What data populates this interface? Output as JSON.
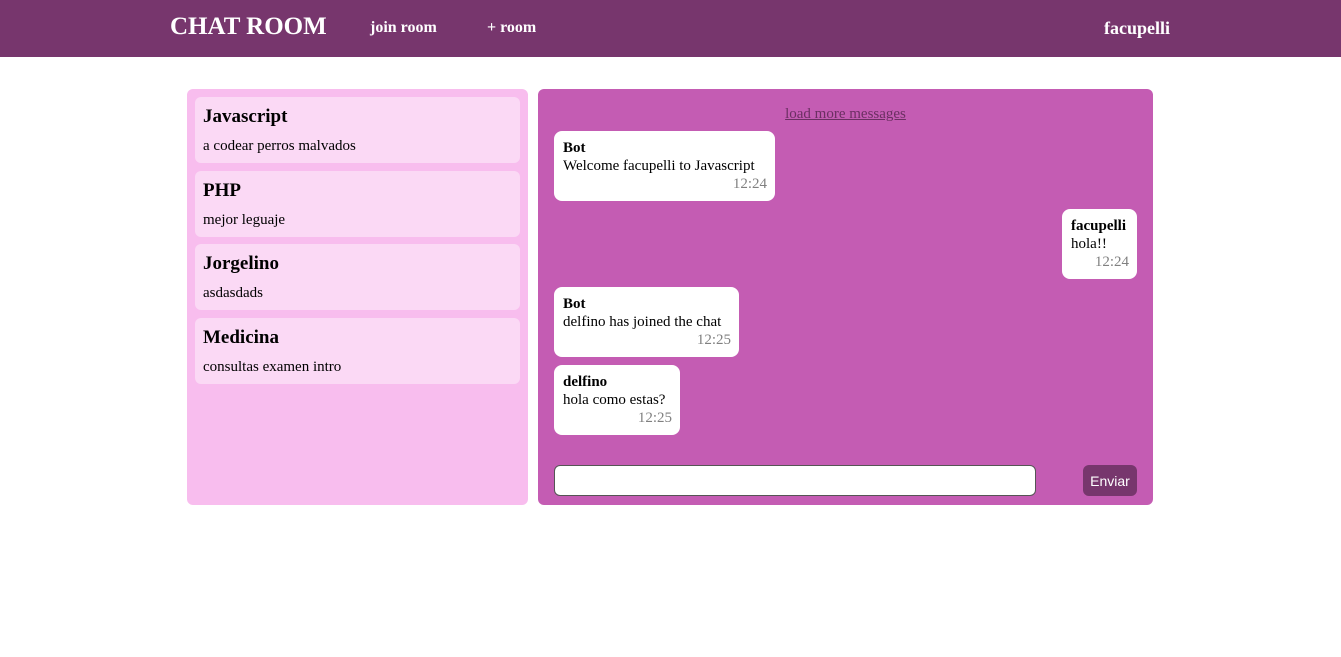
{
  "navbar": {
    "brand": "CHAT ROOM",
    "join_room": "join room",
    "add_room": "+ room",
    "username": "facupelli",
    "background": "#77366d"
  },
  "rooms": [
    {
      "name": "Javascript",
      "description": "a codear perros malvados"
    },
    {
      "name": "PHP",
      "description": "mejor leguaje"
    },
    {
      "name": "Jorgelino",
      "description": "asdasdads"
    },
    {
      "name": "Medicina",
      "description": "consultas examen intro"
    }
  ],
  "chat": {
    "load_more": "load more messages",
    "messages": [
      {
        "author": "Bot",
        "text": "Welcome facupelli to Javascript",
        "time": "12:24"
      },
      {
        "author": "facupelli",
        "text": "hola!!",
        "time": "12:24"
      },
      {
        "author": "Bot",
        "text": "delfino has joined the chat",
        "time": "12:25"
      },
      {
        "author": "delfino",
        "text": "hola como estas?",
        "time": "12:25"
      }
    ],
    "input_value": "",
    "input_placeholder": "",
    "send_label": "Enviar"
  },
  "colors": {
    "rooms_panel": "#f8bdee",
    "room_card": "#fbd9f5",
    "chat_panel": "#c45cb3",
    "message_bubble": "#ffffff"
  }
}
